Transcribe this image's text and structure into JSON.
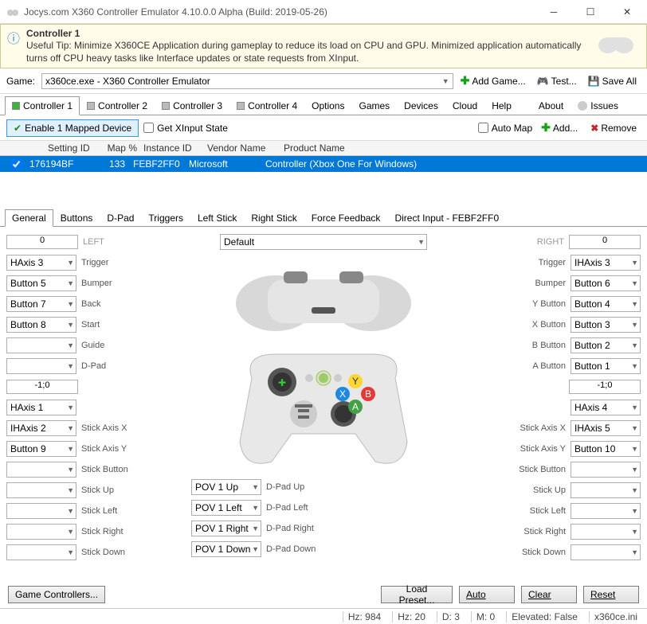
{
  "window": {
    "title": "Jocys.com X360 Controller Emulator 4.10.0.0 Alpha (Build: 2019-05-26)"
  },
  "tip": {
    "title": "Controller 1",
    "body": "Useful Tip: Minimize X360CE Application during gameplay to reduce its load on CPU and GPU. Minimized application automatically turns off CPU heavy tasks like Interface updates or state requests from XInput."
  },
  "gamebar": {
    "label": "Game:",
    "value": "x360ce.exe - X360 Controller Emulator",
    "add": "Add Game...",
    "test": "Test...",
    "save": "Save All"
  },
  "maintabs": [
    "Controller 1",
    "Controller 2",
    "Controller 3",
    "Controller 4",
    "Options",
    "Games",
    "Devices",
    "Cloud",
    "Help",
    "About",
    "Issues"
  ],
  "devbar": {
    "enable": "Enable 1 Mapped Device",
    "getxi": "Get XInput State",
    "automap": "Auto Map",
    "add": "Add...",
    "remove": "Remove"
  },
  "cols": {
    "sid": "Setting ID",
    "mapp": "Map %",
    "iid": "Instance ID",
    "vendor": "Vendor Name",
    "product": "Product Name"
  },
  "row0": {
    "sid": "176194BF",
    "mapp": "133",
    "iid": "FEBF2FF0",
    "vendor": "Microsoft",
    "product": "Controller (Xbox One For Windows)"
  },
  "settabs": [
    "General",
    "Buttons",
    "D-Pad",
    "Triggers",
    "Left Stick",
    "Right Stick",
    "Force Feedback",
    "Direct Input - FEBF2FF0"
  ],
  "map": {
    "leftVal": "0",
    "rightVal": "0",
    "leftHdr": "LEFT",
    "rightHdr": "RIGHT",
    "defaultCombo": "Default",
    "lvals": [
      "HAxis 3",
      "Button 5",
      "Button 7",
      "Button 8",
      "",
      "",
      "-1;0",
      "HAxis 1",
      "IHAxis 2",
      "Button 9",
      "",
      "",
      "",
      "",
      ""
    ],
    "rvals": [
      "IHAxis 3",
      "Button 6",
      "Button 4",
      "Button 3",
      "Button 2",
      "Button 1",
      "-1;0",
      "HAxis 4",
      "IHAxis 5",
      "Button 10",
      "",
      "",
      "",
      "",
      ""
    ],
    "llab": [
      "Trigger",
      "Bumper",
      "Back",
      "Start",
      "Guide",
      "D-Pad",
      "",
      "Stick Axis X",
      "Stick Axis Y",
      "Stick Button",
      "Stick Up",
      "Stick Left",
      "Stick Right",
      "Stick Down"
    ],
    "rlab": [
      "Trigger",
      "Bumper",
      "Y Button",
      "X Button",
      "B Button",
      "A Button",
      "",
      "Stick Axis X",
      "Stick Axis Y",
      "Stick Button",
      "Stick Up",
      "Stick Left",
      "Stick Right",
      "Stick Down"
    ],
    "dpad": [
      {
        "sel": "POV 1 Up",
        "lab": "D-Pad Up"
      },
      {
        "sel": "POV 1 Left",
        "lab": "D-Pad Left"
      },
      {
        "sel": "POV 1 Right",
        "lab": "D-Pad Right"
      },
      {
        "sel": "POV 1 Down",
        "lab": "D-Pad Down"
      }
    ]
  },
  "footer": {
    "gc": "Game Controllers...",
    "load": "Load Preset...",
    "auto": "Auto",
    "clear": "Clear",
    "reset": "Reset"
  },
  "status": {
    "hz1": "Hz: 984",
    "hz2": "Hz: 20",
    "d": "D: 3",
    "m": "M: 0",
    "el": "Elevated: False",
    "ini": "x360ce.ini"
  }
}
